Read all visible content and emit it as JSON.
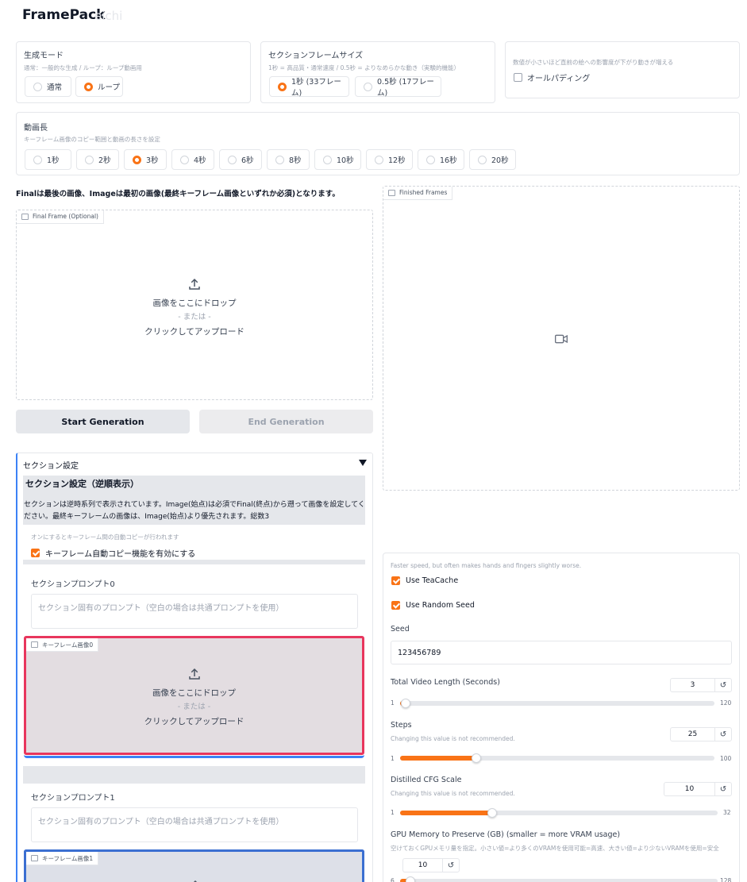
{
  "app": {
    "title": "FramePack",
    "title_ghost": "eichi"
  },
  "gen_mode": {
    "label": "生成モード",
    "info": "通常：一般的な生成 / ループ：ループ動画用",
    "options": [
      "通常",
      "ループ"
    ],
    "selected": "ループ"
  },
  "section_frame": {
    "label": "セクションフレームサイズ",
    "info": "1秒 = 高品質・通常速度 / 0.5秒 = よりなめらかな動き（実験的機能）",
    "options": [
      "1秒 (33フレーム)",
      "0.5秒 (17フレーム)"
    ],
    "selected": "1秒 (33フレーム)"
  },
  "padding": {
    "info": "数値が小さいほど直前の絵への影響度が下がり動きが増える",
    "label": "オールパディング",
    "checked": false
  },
  "video_length": {
    "label": "動画長",
    "info": "キーフレーム画像のコピー範囲と動画の長さを設定",
    "options": [
      "1秒",
      "2秒",
      "3秒",
      "4秒",
      "6秒",
      "8秒",
      "10秒",
      "12秒",
      "16秒",
      "20秒"
    ],
    "selected": "3秒"
  },
  "notice": "Finalは最後の画像、Imageは最初の画像(最終キーフレーム画像といずれか必須)となります。",
  "final_frame": {
    "tag": "Final Frame (Optional)",
    "drop_text": "画像をここにドロップ",
    "or_text": "- または -",
    "click_text": "クリックしてアップロード"
  },
  "finished_frames": {
    "tag": "Finished Frames"
  },
  "buttons": {
    "start": "Start Generation",
    "end": "End Generation"
  },
  "section_settings": {
    "accordion_label": "セクション設定",
    "heading": "セクション設定（逆順表示）",
    "description": "セクションは逆時系列で表示されています。Image(始点)は必須でFinal(終点)から遡って画像を設定してください。最終キーフレームの画像は、Image(始点)より優先されます。総数3",
    "autocopy_info": "オンにするとキーフレーム間の自動コピーが行われます",
    "autocopy_label": "キーフレーム自動コピー機能を有効にする",
    "autocopy_checked": true,
    "sections": [
      {
        "prompt_label": "セクションプロンプト0",
        "prompt_placeholder": "セクション固有のプロンプト（空白の場合は共通プロンプトを使用）",
        "keyframe_tag": "キーフレーム画像0"
      },
      {
        "prompt_label": "セクションプロンプト1",
        "prompt_placeholder": "セクション固有のプロンプト（空白の場合は共通プロンプトを使用）",
        "keyframe_tag": "キーフレーム画像1"
      }
    ],
    "drop_text": "画像をここにドロップ",
    "or_text": "- または -",
    "click_text": "クリックしてアップロード"
  },
  "settings": {
    "teacache_info": "Faster speed, but often makes hands and fingers slightly worse.",
    "teacache_label": "Use TeaCache",
    "teacache_checked": true,
    "random_seed_label": "Use Random Seed",
    "random_seed_checked": true,
    "seed_label": "Seed",
    "seed_value": "123456789",
    "total_length": {
      "label": "Total Video Length (Seconds)",
      "value": "3",
      "min": "1",
      "max": "120",
      "fraction": 0.017
    },
    "steps": {
      "label": "Steps",
      "info": "Changing this value is not recommended.",
      "value": "25",
      "min": "1",
      "max": "100",
      "fraction": 0.242
    },
    "cfg": {
      "label": "Distilled CFG Scale",
      "info": "Changing this value is not recommended.",
      "value": "10",
      "min": "1",
      "max": "32",
      "fraction": 0.29
    },
    "gpu": {
      "label": "GPU Memory to Preserve (GB) (smaller = more VRAM usage)",
      "info": "空けておくGPUメモリ量を指定。小さい値=より多くのVRAMを使用可能=高速、大きい値=より少ないVRAMを使用=安全",
      "value": "10",
      "min": "6",
      "max": "128",
      "fraction": 0.033
    }
  },
  "colors": {
    "accent": "#f97316",
    "selected_border": "#e8365d",
    "accordion_border": "#3b82f6"
  }
}
